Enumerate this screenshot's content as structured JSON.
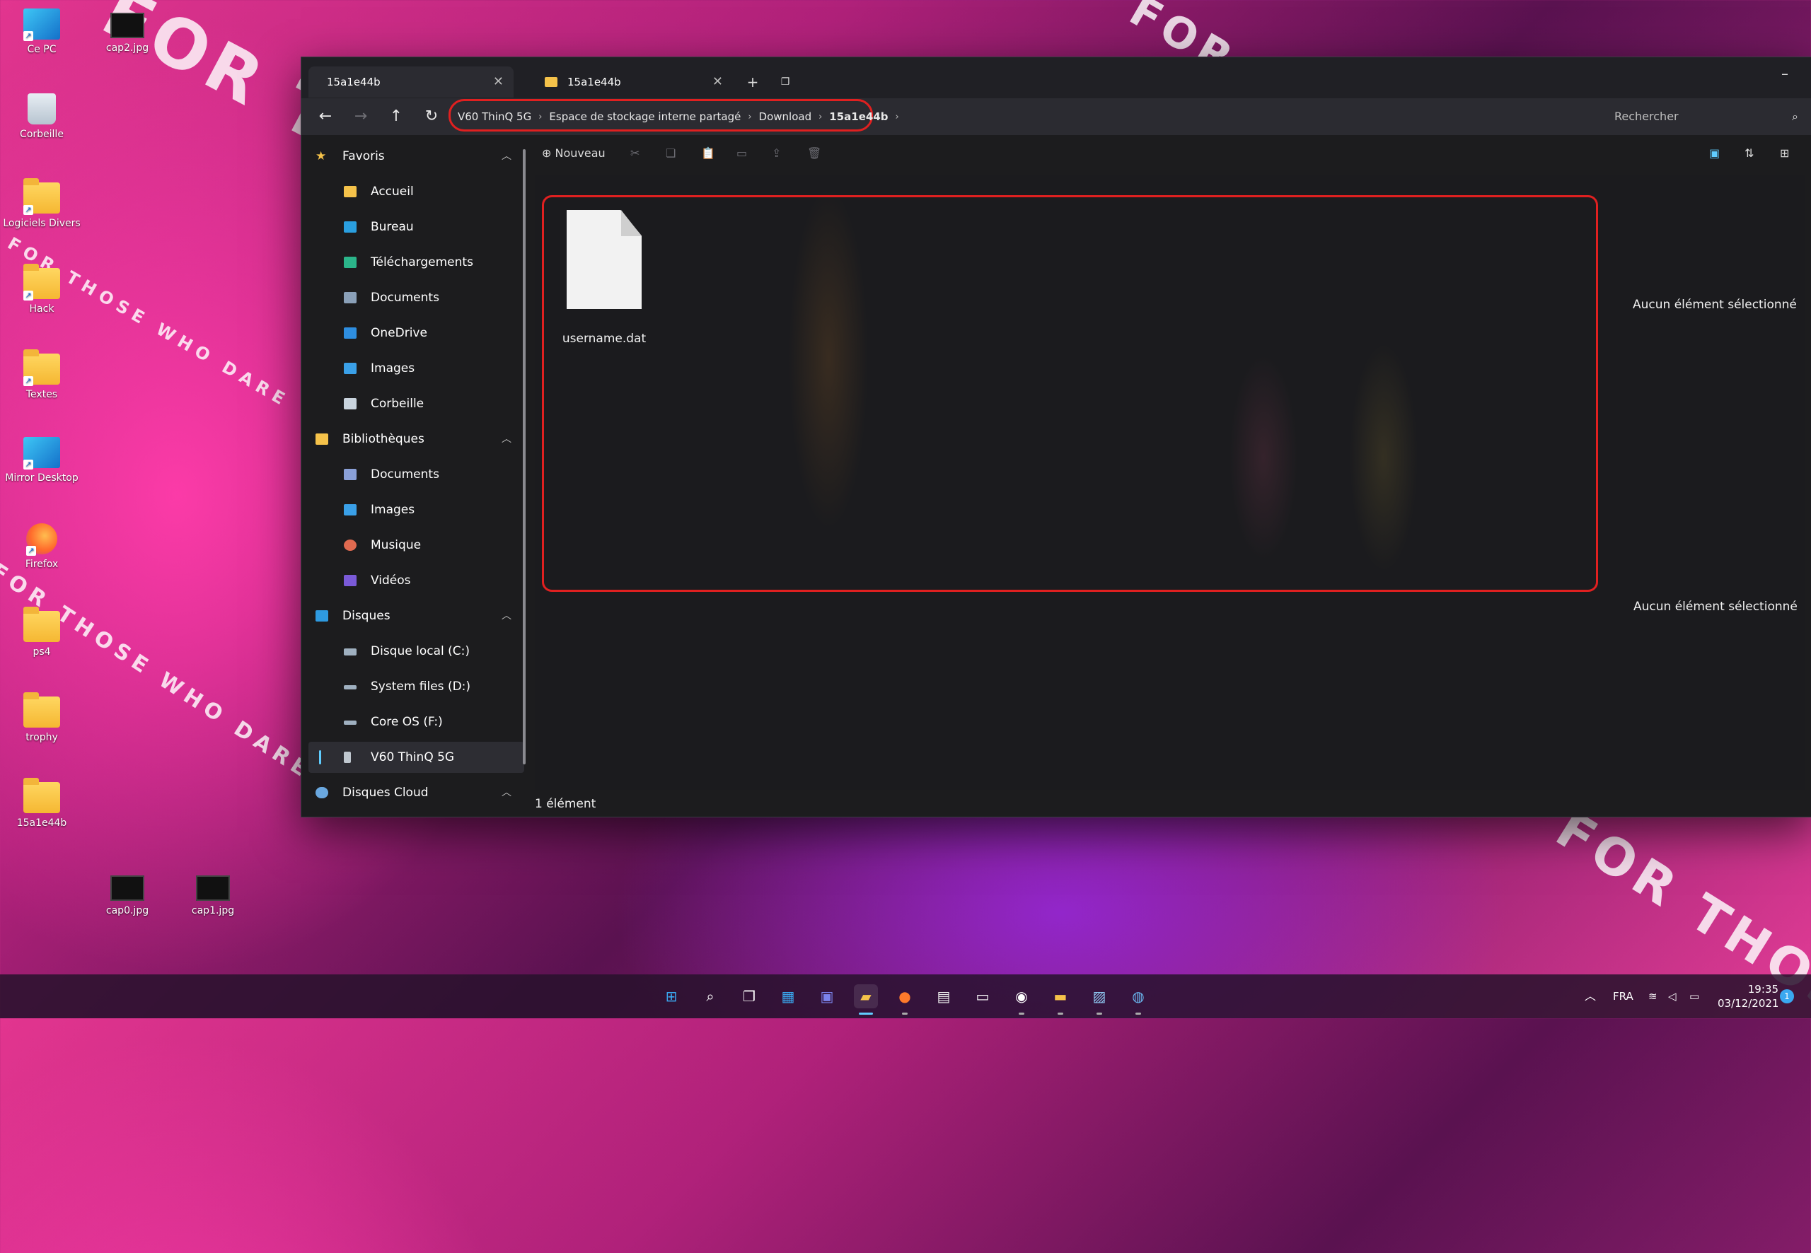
{
  "desktop": {
    "icons": [
      {
        "label": "Ce PC"
      },
      {
        "label": "cap2.jpg"
      },
      {
        "label": "Corbeille"
      },
      {
        "label": "Logiciels Divers"
      },
      {
        "label": "Hack"
      },
      {
        "label": "Textes"
      },
      {
        "label": "Mirror Desktop"
      },
      {
        "label": "Firefox"
      },
      {
        "label": "ps4"
      },
      {
        "label": "trophy"
      },
      {
        "label": "15a1e44b"
      },
      {
        "label": "cap0.jpg"
      },
      {
        "label": "cap1.jpg"
      }
    ],
    "wallpaper_text": "FOR THOSE WHO DARE"
  },
  "window": {
    "tabs": [
      {
        "label": "15a1e44b",
        "active": true
      },
      {
        "label": "15a1e44b",
        "active": false
      }
    ],
    "new_tab": "+",
    "minimize": "–",
    "breadcrumb": [
      "V60 ThinQ 5G",
      "Espace de stockage interne partagé",
      "Download",
      "15a1e44b"
    ],
    "search_placeholder": "Rechercher",
    "toolbar": {
      "new_label": "Nouveau"
    },
    "sidebar": {
      "favoris": {
        "label": "Favoris",
        "items": [
          "Accueil",
          "Bureau",
          "Téléchargements",
          "Documents",
          "OneDrive",
          "Images",
          "Corbeille"
        ]
      },
      "bibliotheques": {
        "label": "Bibliothèques",
        "items": [
          "Documents",
          "Images",
          "Musique",
          "Vidéos"
        ]
      },
      "disques": {
        "label": "Disques",
        "items": [
          "Disque local (C:)",
          "System files (D:)",
          "Core OS (F:)",
          "V60 ThinQ 5G"
        ]
      },
      "cloud": {
        "label": "Disques Cloud"
      }
    },
    "files": [
      {
        "name": "username.dat"
      }
    ],
    "details": {
      "line1": "Aucun élément sélectionné",
      "line2": "Aucun élément sélectionné"
    },
    "status": "1 élément"
  },
  "taskbar": {
    "tray": {
      "lang": "FRA",
      "time": "19:35",
      "date": "03/12/2021",
      "notifications": "1"
    }
  },
  "colors": {
    "highlight_red": "#e02020",
    "accent": "#60cdff"
  }
}
